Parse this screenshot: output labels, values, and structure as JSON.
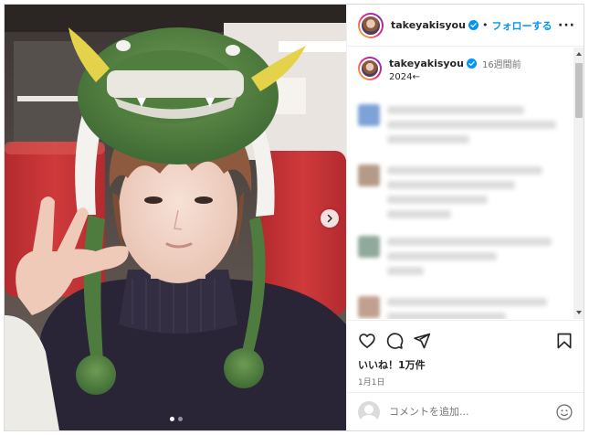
{
  "post": {
    "username": "takeyakisyou",
    "separator": "•",
    "follow_label": "フォローする",
    "more_label": "···",
    "caption_time": "16週間前",
    "caption_text": "2024←",
    "likes_text": "いいね！1万件",
    "date_text": "1月1日",
    "comment_placeholder": "コメントを追加...",
    "carousel_total_slides": 2,
    "carousel_current_slide": 1
  },
  "icons": {
    "verified": "verified-badge-icon",
    "like": "heart-icon",
    "comment": "comment-bubble-icon",
    "share": "paper-plane-icon",
    "save": "bookmark-icon",
    "emoji": "smiley-icon",
    "next": "chevron-right-icon"
  },
  "colors": {
    "accent": "#0095f6",
    "verified": "#0095f6",
    "text": "#262626",
    "muted": "#737373",
    "border": "#efefef"
  }
}
